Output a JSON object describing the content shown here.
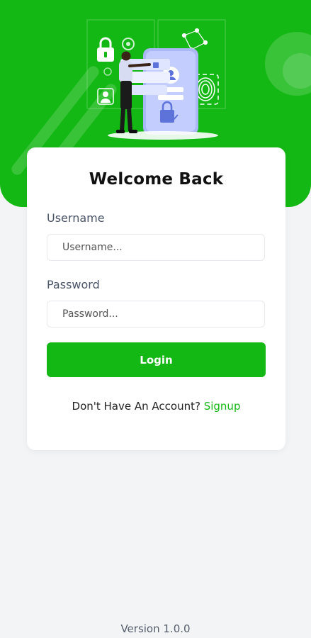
{
  "header": {
    "illustration_icons": [
      "lock-icon",
      "gear-icon",
      "user-icon",
      "fingerprint-icon",
      "phone-icon",
      "person-figure"
    ]
  },
  "card": {
    "title": "Welcome Back",
    "username_label": "Username",
    "username_placeholder": "Username...",
    "username_value": "",
    "password_label": "Password",
    "password_placeholder": "Password...",
    "password_value": "",
    "login_label": "Login",
    "signup_prompt": "Don't Have An Account?",
    "signup_link": "Signup"
  },
  "footer": {
    "version": "Version 1.0.0"
  },
  "colors": {
    "accent": "#14b814",
    "background": "#f2f4f6",
    "card": "#ffffff"
  }
}
